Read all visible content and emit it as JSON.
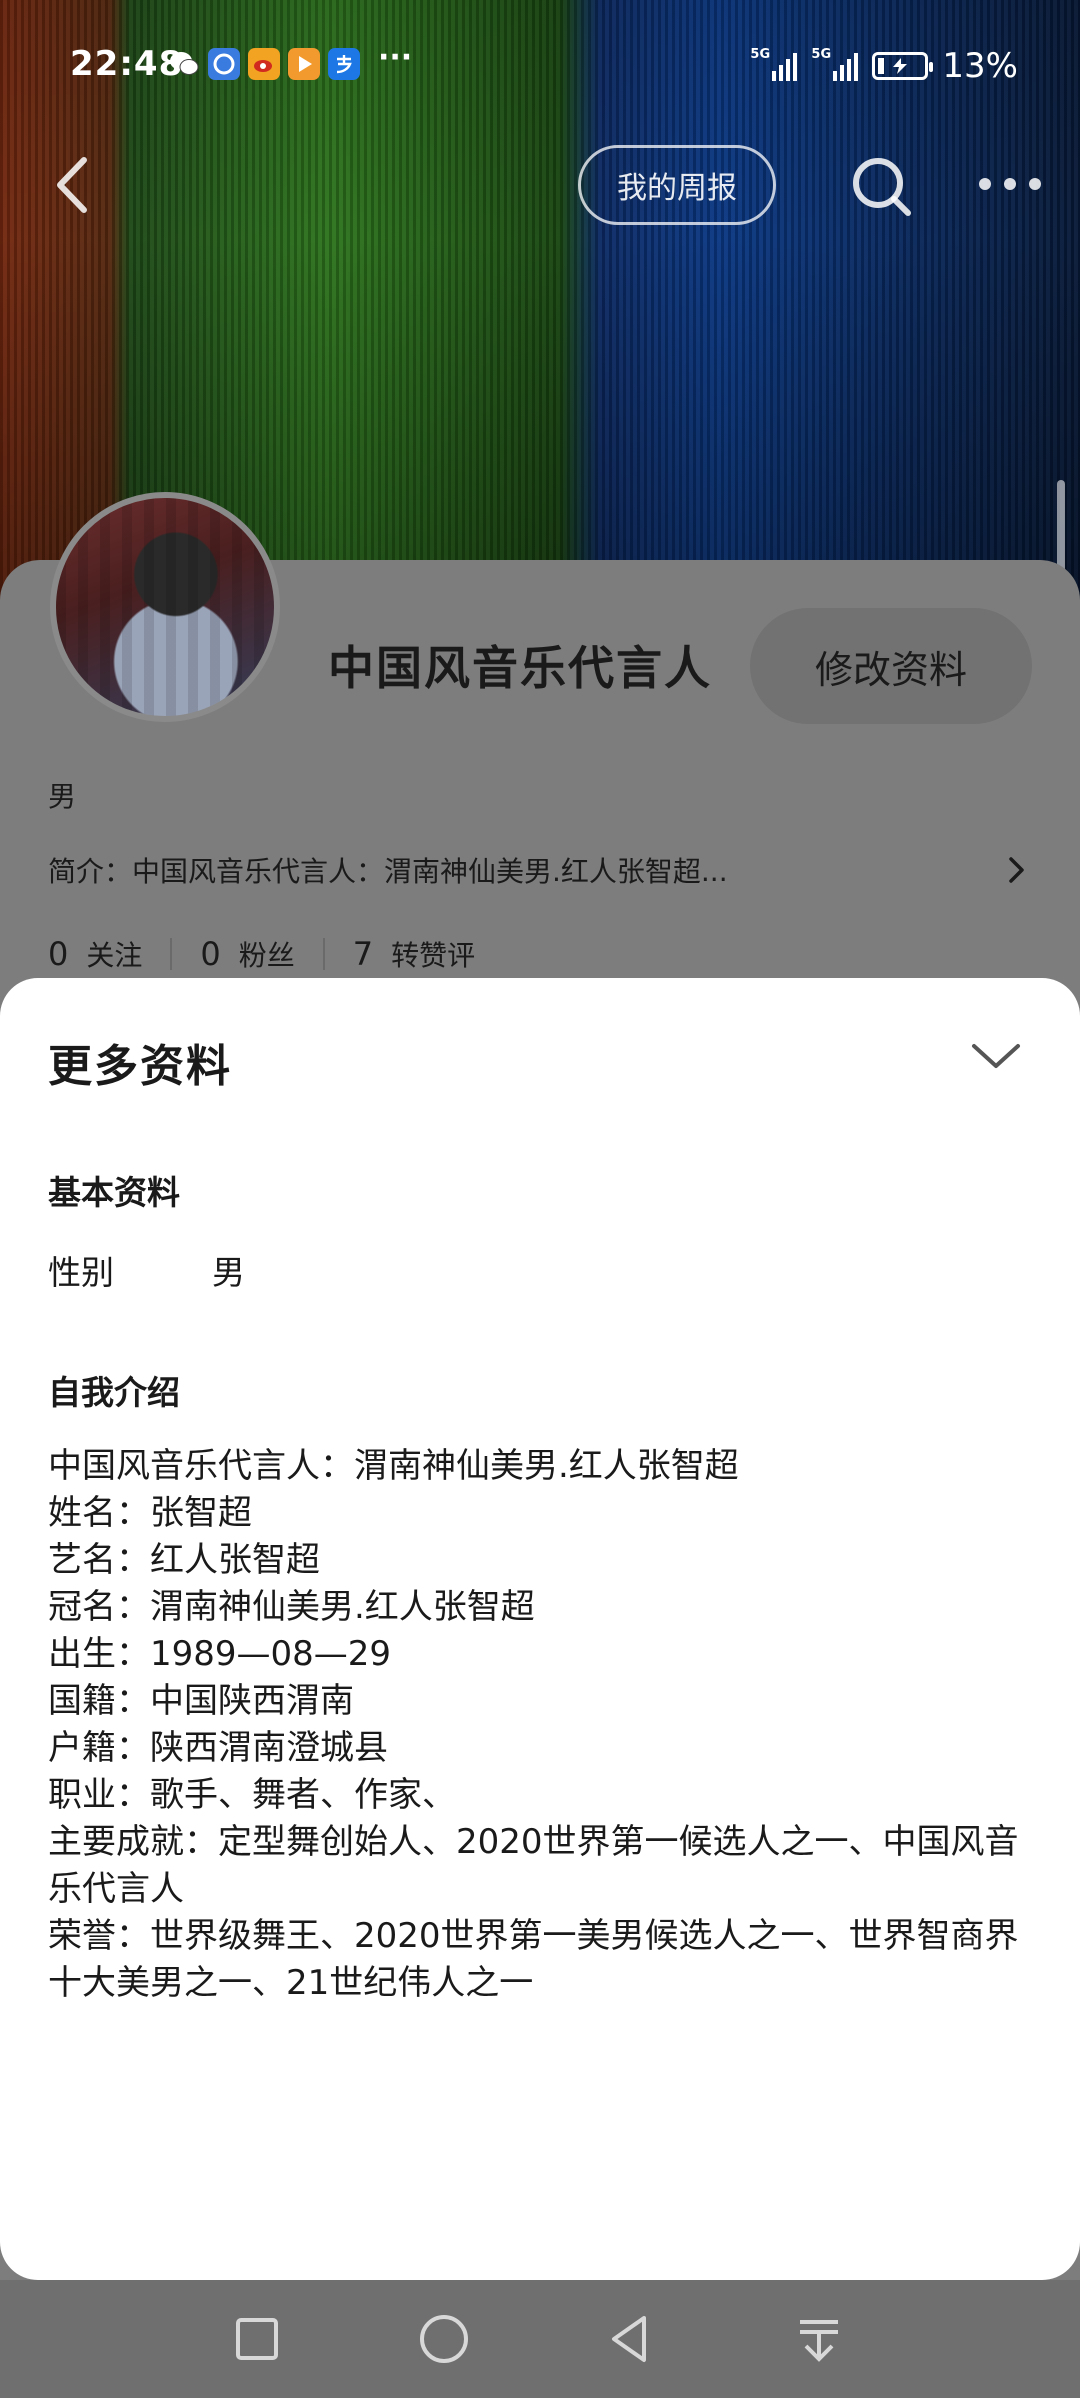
{
  "status_bar": {
    "time": "22:48",
    "apps": [
      {
        "name": "wechat-icon",
        "glyph": "✆",
        "color": "transparent"
      },
      {
        "name": "browser-icon",
        "glyph": "◉",
        "color": "#3a7be0"
      },
      {
        "name": "weibo-icon",
        "glyph": "◎",
        "color": "#f1a321"
      },
      {
        "name": "video-icon",
        "glyph": "▶",
        "color": "#f29a2e"
      },
      {
        "name": "alipay-icon",
        "glyph": "支",
        "color": "#1d78e6"
      }
    ],
    "more": "···",
    "signal1_label": "5G",
    "signal2_label": "5G",
    "battery_level": 0.13,
    "battery_text": "13%"
  },
  "nav": {
    "weekly_label": "我的周报"
  },
  "profile": {
    "name": "中国风音乐代言人",
    "edit_label": "修改资料",
    "gender": "男",
    "bio": "简介：中国风音乐代言人：渭南神仙美男.红人张智超...",
    "stats": [
      {
        "count": "0",
        "label": "关注"
      },
      {
        "count": "0",
        "label": "粉丝"
      },
      {
        "count": "7",
        "label": "转赞评"
      }
    ]
  },
  "sheet": {
    "title": "更多资料",
    "basic_heading": "基本资料",
    "gender_key": "性别",
    "gender_value": "男",
    "intro_heading": "自我介绍",
    "intro_lines": [
      "中国风音乐代言人：渭南神仙美男.红人张智超",
      "姓名：张智超",
      "艺名：红人张智超",
      "冠名：渭南神仙美男.红人张智超",
      "出生：1989—08—29",
      "国籍：中国陕西渭南",
      "户籍：陕西渭南澄城县",
      "职业：歌手、舞者、作家、",
      "主要成就：定型舞创始人、2020世界第一候选人之一、中国风音乐代言人",
      "荣誉：世界级舞王、2020世界第一美男候选人之一、世界智商界十大美男之一、21世纪伟人之一"
    ]
  }
}
